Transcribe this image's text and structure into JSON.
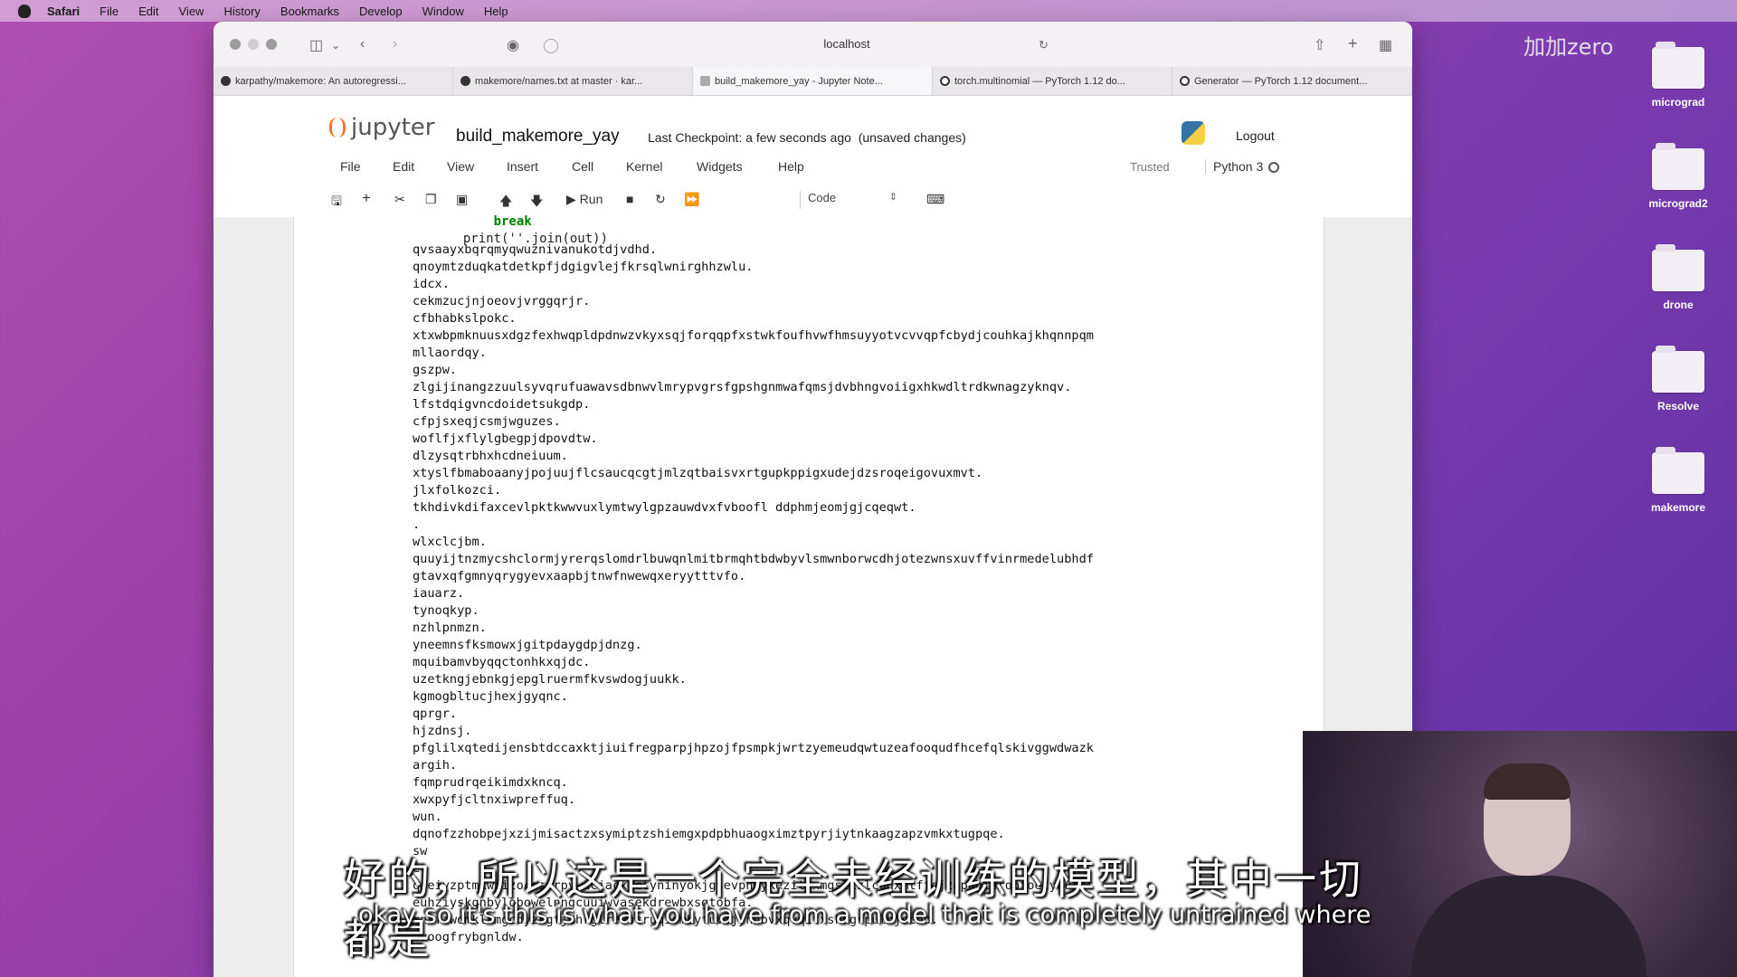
{
  "menubar": {
    "items": [
      "Safari",
      "File",
      "Edit",
      "View",
      "History",
      "Bookmarks",
      "Develop",
      "Window",
      "Help"
    ]
  },
  "watermark": "加加zero",
  "desktop": {
    "icons": [
      "micrograd",
      "micrograd2",
      "drone",
      "Resolve",
      "makemore"
    ]
  },
  "browser": {
    "address": "localhost",
    "tabs": [
      "karpathy/makemore: An autoregressi...",
      "makemore/names.txt at master · kar...",
      "build_makemore_yay - Jupyter Note...",
      "torch.multinomial — PyTorch 1.12 do...",
      "Generator — PyTorch 1.12 document..."
    ]
  },
  "jupyter": {
    "logo_text": "jupyter",
    "notebook_title": "build_makemore_yay",
    "checkpoint": "Last Checkpoint: a few seconds ago",
    "unsaved": "(unsaved changes)",
    "logout": "Logout",
    "menu": [
      "File",
      "Edit",
      "View",
      "Insert",
      "Cell",
      "Kernel",
      "Widgets",
      "Help"
    ],
    "trusted": "Trusted",
    "kernel": "Python 3",
    "toolbar": {
      "run_label": "Run",
      "cell_type": "Code"
    }
  },
  "code_tail": {
    "line1": "break",
    "line2": "print(''.join(out))"
  },
  "output_lines": [
    "qvsaayxbqrqmyqwuznivanukotdjvdhd.",
    "qnoymtzduqkatdetkpfjdgigvlejfkrsqlwnirghhzwlu.",
    "idcx.",
    "cekmzucjnjoeovjvrggqrjr.",
    "cfbhabkslpokc.",
    "xtxwbpmknuusxdgzfexhwqpldpdnwzvkyxsqjforqqpfxstwkfoufhvwfhmsuyyotvcvvqpfcbydjcouhkajkhqnnpqm",
    "mllaordqy.",
    "gszpw.",
    "zlgijinangzzuulsyvqrufuawavsdbnwvlmrypvgrsfgpshgnmwafqmsjdvbhngvoiigxhkwdltrdkwnagzyknqv.",
    "lfstdqigvncdoidetsukgdp.",
    "cfpjsxeqjcsmjwguzes.",
    "woflfjxflylgbegpjdpovdtw.",
    "dlzysqtrbhxhcdneiuum.",
    "xtyslfbmaboaanyjpojuujflcsaucqcgtjmlzqtbaisvxrtgupkppigxudejdzsroqeigovuxmvt.",
    "jlxfolkozci.",
    "tkhdivkdifaxcevlpktkwwvuxlymtwylgpzauwdvxfvboofl ddphmjeomjgjcqeqwt.",
    ".",
    "wlxclcjbm.",
    "quuyijtnzmycshclormjyrerqslomdrlbuwqnlmitbrmqhtbdwbyvlsmwnborwcdhjotezwnsxuvffvinrmedelubhdf",
    "gtavxqfgmnyqrygyevxaapbjtnwfnwewqxeryytttvfo.",
    "iauarz.",
    "tynoqkyp.",
    "nzhlpnmzn.",
    "yneemnsfksmowxjgitpdaygdpjdnzg.",
    "mquibamvbyqqctonhkxqjdc.",
    "uzetkngjebnkgjepglruermfkvswdogjuukk.",
    "kgmogbltucjhexjgyqnc.",
    "qprgr.",
    "hjzdnsj.",
    "pfglilxqtedijensbtdccaxktjiuifregparpjhpzojfpsmpkjwrtzyemeudqwtuzeafooqudfhcefqlskivggwdwazk",
    "argih.",
    "fqmprudrqeikimdxkncq.",
    "xwxpyfjcltnxiwpreffuq.",
    "wun.",
    "dqnofzzhobpejxzijmisactzxsymiptzshiemgxpdpbhuaogximztpyrjiytnkaagzapzvmkxtugpqe.",
    "sw",
    "e",
    "qaeiyzptmkwpizocasmrpywacjacxgctyninyokjgsevphwykezithxmgslizlcodxmtffejzapnhihropfoetytulct",
    "euhziyskgnbylobowelnngcuuiwvasekdrewbxsgtobfa.",
    "mnsfzwdmklkmgcdyzkgfjdhrglrevocruqidmbyfuvojynhbvxqvqitxsksgrpulbjsebb.",
    "wvoogfrybgnldw."
  ],
  "subtitles": {
    "chinese": "好的，所以这是一个完全未经训练的模型，其中一切都是",
    "english": "okay so it's this is what you have from a model that is completely untrained where"
  },
  "colors": {
    "jupyter_orange": "#f37726",
    "code_keyword": "#008000"
  }
}
